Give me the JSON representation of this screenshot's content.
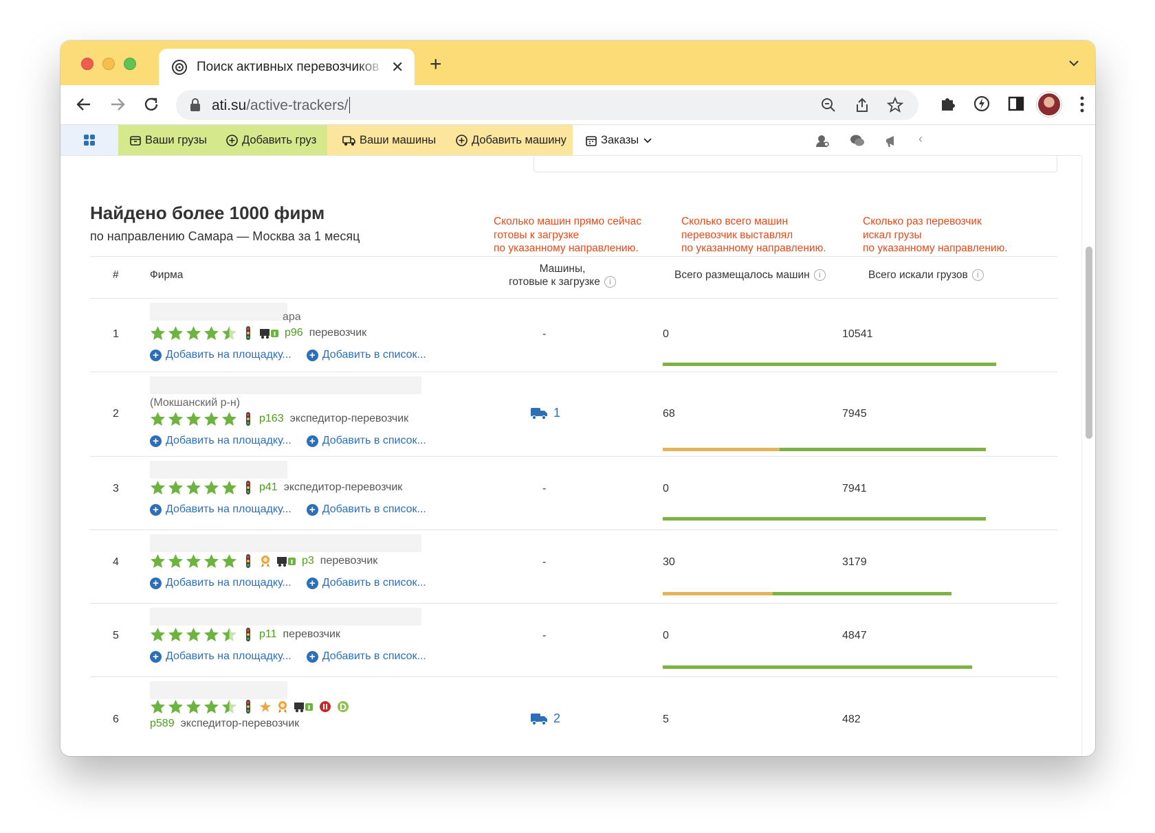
{
  "browser": {
    "tab_title": "Поиск активных перевозчиков",
    "url_host": "ati.su",
    "url_path": "/active-trackers/"
  },
  "sitenav": {
    "items": [
      {
        "label": "Ваши грузы",
        "icon": "box-icon"
      },
      {
        "label": "Добавить груз",
        "icon": "plus-circle-icon"
      },
      {
        "label": "Ваши машины",
        "icon": "truck-icon"
      },
      {
        "label": "Добавить машину",
        "icon": "plus-circle-icon"
      },
      {
        "label": "Заказы",
        "icon": "calendar-icon"
      }
    ]
  },
  "header": {
    "title": "Найдено более 1000 фирм",
    "subtitle": "по направлению Самара — Москва за 1 месяц"
  },
  "notes": {
    "ready": "Сколько машин прямо сейчас\nготовы к загрузке\nпо указанному направлению.",
    "posted": "Сколько всего машин\nперевозчик выставлял\nпо указанному направлению.",
    "searched": "Сколько раз перевозчик\nискал грузы\nпо указанному направлению."
  },
  "table": {
    "col_num": "#",
    "col_firm": "Фирма",
    "col_ready_line1": "Машины,",
    "col_ready_line2": "готовые к загрузке",
    "col_posted": "Всего размещалось машин",
    "col_searched": "Всего искали грузов",
    "info_glyph": "i",
    "action_add_platform": "Добавить на площадку...",
    "action_add_list": "Добавить в список...",
    "rows": [
      {
        "num": "1",
        "firm_tail": "ара",
        "location": "",
        "stars": 4.5,
        "rating": "р96",
        "type": "перевозчик",
        "ready": "-",
        "posted": "0",
        "searched": "10541",
        "bar_orange": 0,
        "bar_green": 0.97
      },
      {
        "num": "2",
        "firm_tail": "",
        "location": "(Мокшанский р-н)",
        "stars": 5,
        "rating": "р163",
        "type": "экспедитор-перевозчик",
        "ready": "1",
        "posted": "68",
        "searched": "7945",
        "bar_orange": 0.34,
        "bar_green": 0.6
      },
      {
        "num": "3",
        "firm_tail": "",
        "location": "",
        "stars": 5,
        "rating": "р41",
        "type": "экспедитор-перевозчик",
        "ready": "-",
        "posted": "0",
        "searched": "7941",
        "bar_orange": 0,
        "bar_green": 0.94
      },
      {
        "num": "4",
        "firm_tail": "",
        "location": "",
        "stars": 5,
        "rating": "р3",
        "type": "перевозчик",
        "ready": "-",
        "posted": "30",
        "searched": "3179",
        "bar_orange": 0.32,
        "bar_green": 0.52
      },
      {
        "num": "5",
        "firm_tail": "",
        "location": "",
        "stars": 4.5,
        "rating": "р11",
        "type": "перевозчик",
        "ready": "-",
        "posted": "0",
        "searched": "4847",
        "bar_orange": 0,
        "bar_green": 0.9
      },
      {
        "num": "6",
        "firm_tail": "",
        "location": "",
        "stars": 4.5,
        "rating": "р589",
        "type": "экспедитор-перевозчик",
        "ready": "2",
        "posted": "5",
        "searched": "482",
        "bar_orange": 0,
        "bar_green": 0
      }
    ]
  },
  "colors": {
    "accent_green": "#7cb342",
    "accent_orange": "#e5b45a",
    "link_blue": "#2d6fb6",
    "note_red": "#e64a19",
    "title_bar": "#fbdc77"
  }
}
